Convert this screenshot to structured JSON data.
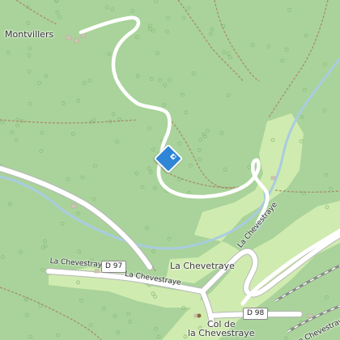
{
  "map": {
    "colors": {
      "forest": "#a9d39a",
      "meadow": "#d0ebb0",
      "water": "#a9cce0",
      "road": "#ffffff",
      "poi": "#2f86d6"
    },
    "places": {
      "village_north": "Montvillers",
      "hamlet": "La Chevetraye",
      "pass_line1": "Col de",
      "pass_line2": "la Chevestraye"
    },
    "road_labels": {
      "west": "La Chevestraye",
      "south": "La Chevestraye",
      "east": "La Chevestraye",
      "southeast": "La Chevestraye"
    },
    "route_shields": {
      "west": "D 97",
      "east": "D 98"
    },
    "marker": {
      "icon": "hiking-direction-icon"
    }
  }
}
